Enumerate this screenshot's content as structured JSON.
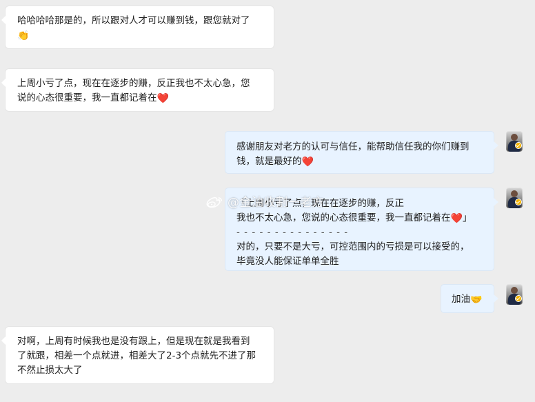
{
  "watermark": {
    "text": "@金油收割一老方"
  },
  "messages": [
    {
      "lines": [
        "哈哈哈哈那是的，所以跟对人才可以赚到钱，跟您就对了"
      ],
      "emoji": "👏"
    },
    {
      "lines": [
        "上周小亏了点，现在在逐步的赚，反正我也不太心急，您",
        "说的心态很重要，我一直都记着在"
      ],
      "emoji": "❤️"
    },
    {
      "lines": [
        "感谢朋友对老方的认可与信任，能帮助信任我的你们赚到",
        "钱，就是最好的"
      ],
      "emoji": "❤️"
    },
    {
      "quote_line_1": "「上周小亏了点，现在在逐步的赚，反正",
      "quote_line_2": "我也不太心急，您说的心态很重要，我一直都记着在",
      "quote_emoji": "❤️",
      "quote_end": "」",
      "separator": "- - - - - - - - - - - - - - -",
      "reply_lines": [
        "对的，只要不是大亏，可控范围内的亏损是可以接受的，",
        "毕竟没人能保证单单全胜"
      ]
    },
    {
      "text": "加油",
      "emoji": "🤝"
    },
    {
      "lines": [
        "对啊，上周有时候我也是没有跟上，但是现在就是我看到",
        "了就跟，相差一个点就进，相差大了2-3个点就先不进了那",
        "不然止损太大了"
      ]
    }
  ]
}
